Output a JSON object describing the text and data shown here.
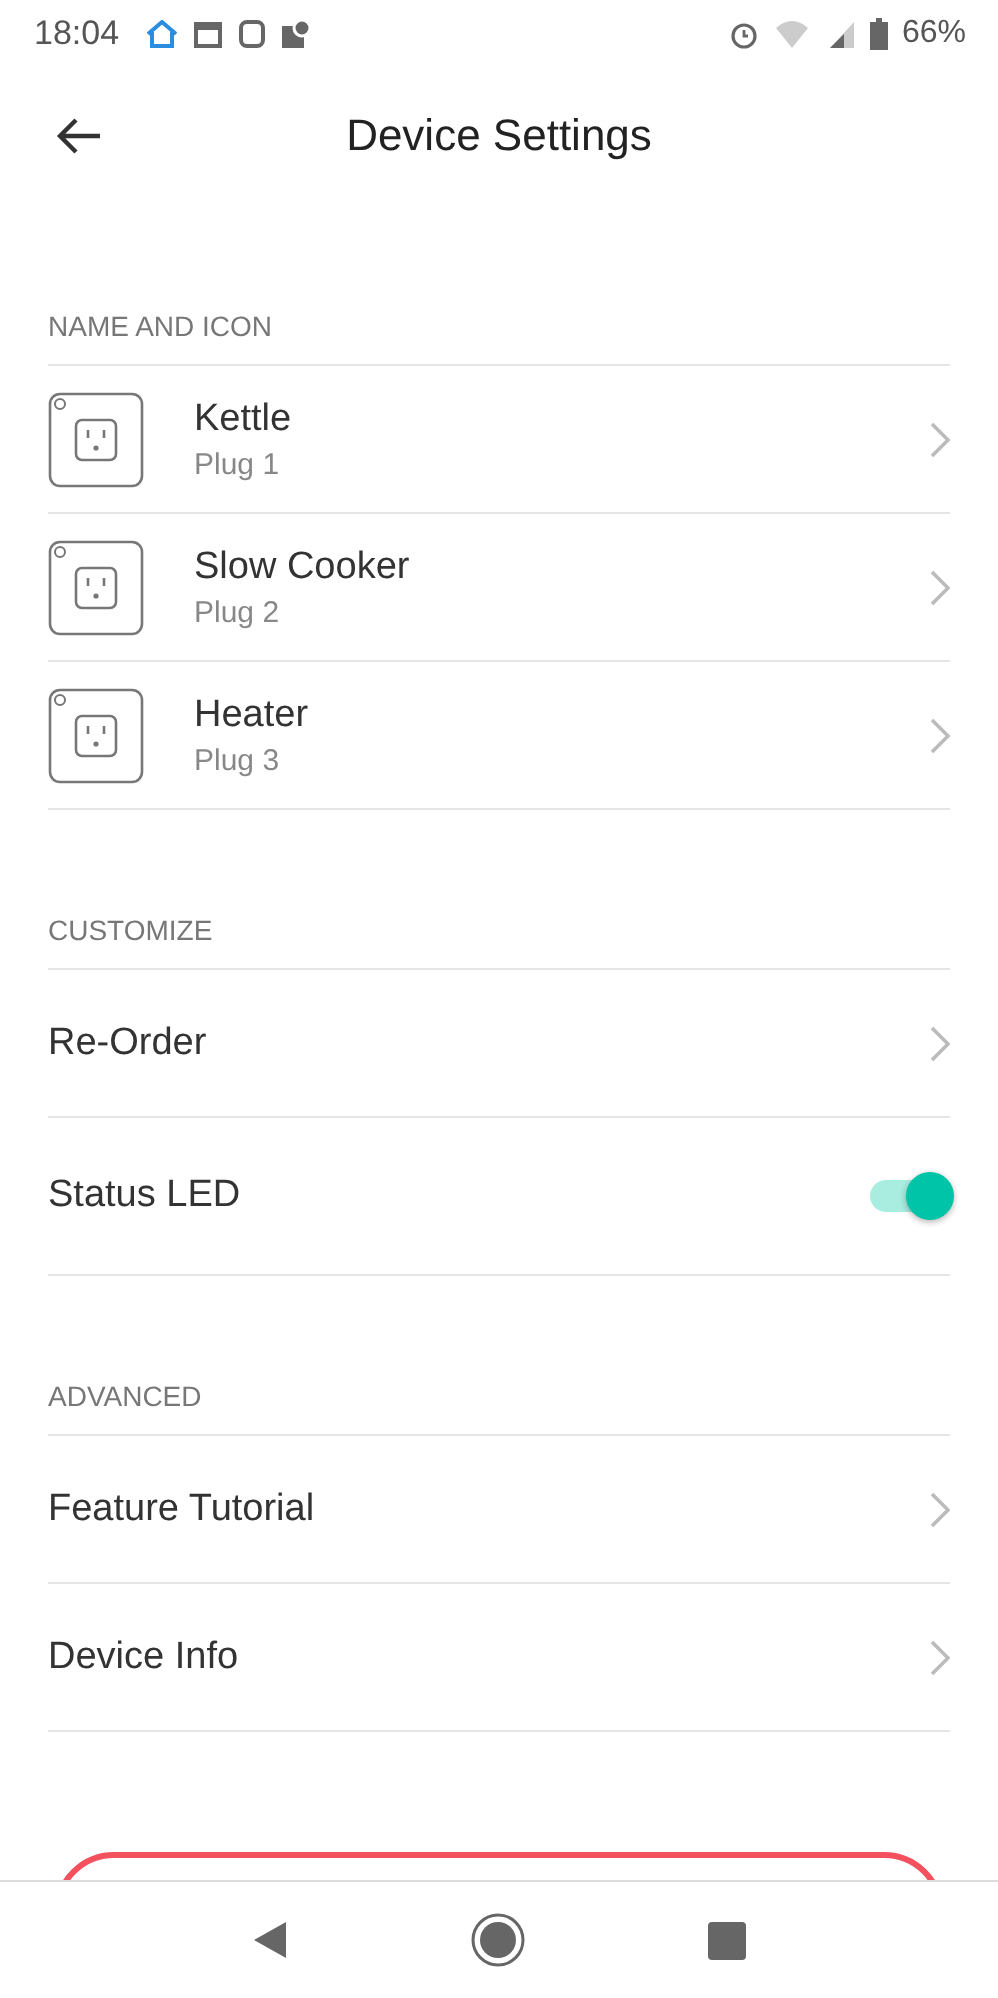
{
  "status_bar": {
    "time": "18:04",
    "battery": "66%"
  },
  "header": {
    "title": "Device Settings"
  },
  "sections": [
    {
      "title": "NAME AND ICON",
      "items": [
        {
          "kind": "device",
          "label": "Kettle",
          "sublabel": "Plug 1"
        },
        {
          "kind": "device",
          "label": "Slow Cooker",
          "sublabel": "Plug 2"
        },
        {
          "kind": "device",
          "label": "Heater",
          "sublabel": "Plug 3"
        }
      ]
    },
    {
      "title": "CUSTOMIZE",
      "items": [
        {
          "kind": "link",
          "label": "Re-Order"
        },
        {
          "kind": "toggle",
          "label": "Status LED",
          "on": true
        }
      ]
    },
    {
      "title": "ADVANCED",
      "items": [
        {
          "kind": "link",
          "label": "Feature Tutorial"
        },
        {
          "kind": "link",
          "label": "Device Info"
        }
      ]
    }
  ]
}
